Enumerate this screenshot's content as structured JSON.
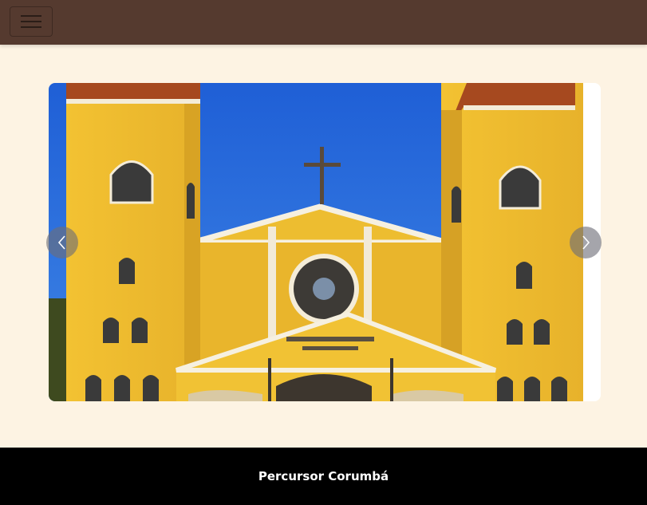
{
  "navbar": {
    "background": "#553a2f",
    "toggle_icon": "hamburger-menu-icon"
  },
  "carousel": {
    "slide_image_description": "church-facade-image",
    "prev_icon": "chevron-left-icon",
    "next_icon": "chevron-right-icon"
  },
  "footer": {
    "text": "Percursor Corumbá"
  },
  "colors": {
    "page_background": "#fdf3e3",
    "footer_background": "#000000"
  }
}
